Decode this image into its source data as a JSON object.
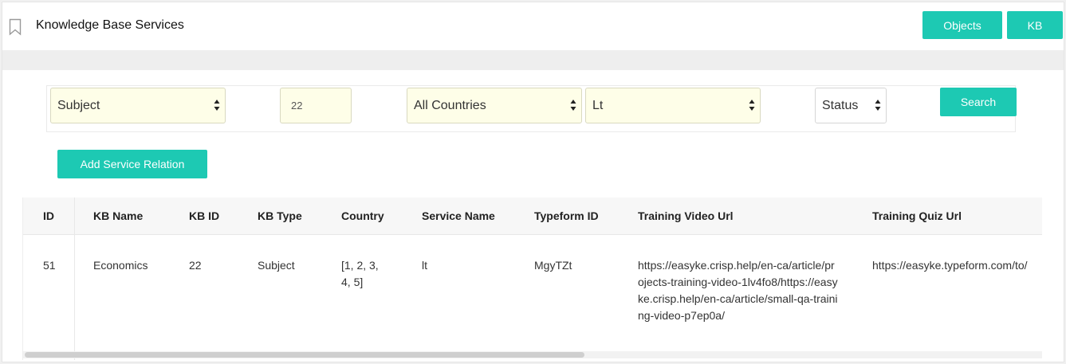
{
  "header": {
    "title": "Knowledge Base Services",
    "buttons": {
      "objects": "Objects",
      "kb": "KB"
    }
  },
  "filters": {
    "type_select": "Subject",
    "id_input": "22",
    "country_select": "All Countries",
    "service_select": "Lt",
    "status_select": "Status",
    "search_label": "Search"
  },
  "actions": {
    "add_label": "Add Service Relation"
  },
  "table": {
    "headers": {
      "id": "ID",
      "kb_name": "KB Name",
      "kb_id": "KB ID",
      "kb_type": "KB Type",
      "country": "Country",
      "service_name": "Service Name",
      "typeform_id": "Typeform ID",
      "training_video_url": "Training Video Url",
      "training_quiz_url": "Training Quiz Url"
    },
    "rows": [
      {
        "id": "51",
        "kb_name": "Economics",
        "kb_id": "22",
        "kb_type": "Subject",
        "country": "[1, 2, 3, 4, 5]",
        "service_name": "lt",
        "typeform_id": "MgyTZt",
        "training_video_url": "https://easyke.crisp.help/en-ca/article/projects-training-video-1lv4fo8/https://easyke.crisp.help/en-ca/article/small-qa-training-video-p7ep0a/",
        "training_quiz_url": "https://easyke.typeform.com/to/"
      }
    ]
  },
  "colors": {
    "accent": "#1dc9b3",
    "select_bg": "#fefee8"
  }
}
